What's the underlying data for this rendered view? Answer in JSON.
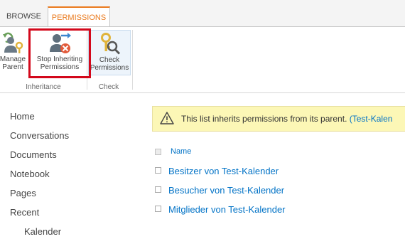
{
  "ribbon": {
    "tabs": [
      {
        "label": "BROWSE",
        "active": false
      },
      {
        "label": "PERMISSIONS",
        "active": true
      }
    ],
    "accent_color": "#ea7a1e",
    "groups": [
      {
        "label": "Inheritance",
        "buttons": [
          {
            "label_line1": "Manage",
            "label_line2": "Parent",
            "icon": "manage-parent-icon"
          },
          {
            "label_line1": "Stop Inheriting",
            "label_line2": "Permissions",
            "icon": "stop-inheriting-icon",
            "highlighted": true
          }
        ]
      },
      {
        "label": "Check",
        "buttons": [
          {
            "label_line1": "Check",
            "label_line2": "Permissions",
            "icon": "check-permissions-icon"
          }
        ]
      }
    ],
    "highlight_color": "#d3081b"
  },
  "nav": {
    "items": [
      "Home",
      "Conversations",
      "Documents",
      "Notebook",
      "Pages",
      "Recent"
    ],
    "sub_items": [
      "Kalender"
    ]
  },
  "banner": {
    "message": "This list inherits permissions from its parent.",
    "link_text": "(Test-Kalen",
    "icon": "warning-icon"
  },
  "list": {
    "column_header": "Name",
    "rows": [
      "Besitzer von Test-Kalender",
      "Besucher von Test-Kalender",
      "Mitglieder von Test-Kalender"
    ]
  }
}
